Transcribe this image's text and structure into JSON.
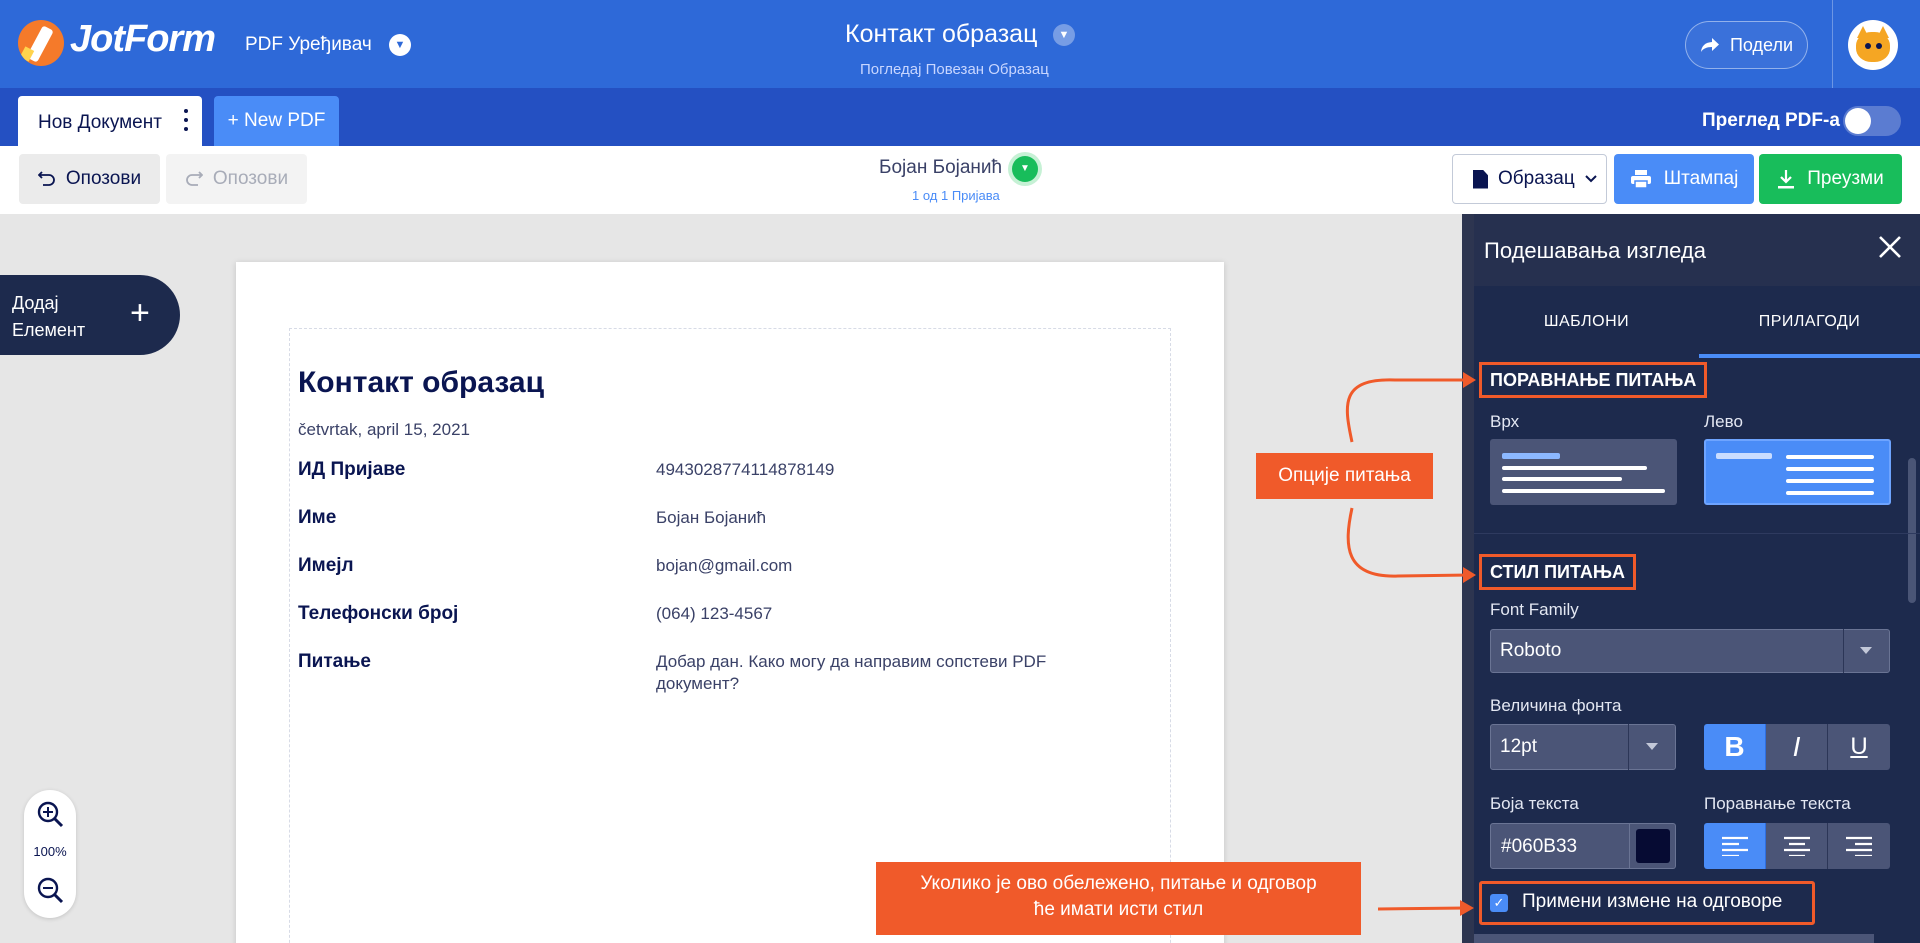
{
  "header": {
    "logo_text": "JotForm",
    "app_name": "PDF Уређивач",
    "form_title": "Контакт образац",
    "form_subtitle": "Погледај Повезан Образац",
    "share_label": "Подели"
  },
  "tabs": {
    "document_label": "Нов Документ",
    "new_pdf_label": "+ New PDF",
    "preview_label": "Преглед PDF-а",
    "preview_on": false
  },
  "toolbar": {
    "undo_label": "Опозови",
    "redo_label": "Опозови",
    "submitter_name": "Бојан Бојанић",
    "submission_count": "1 од 1 Пријава",
    "template_label": "Образац",
    "print_label": "Штампај",
    "download_label": "Преузми"
  },
  "canvas": {
    "add_element_label": "Додај Елемент",
    "zoom_level": "100%"
  },
  "document": {
    "title": "Контакт образац",
    "date": "četvrtak, april 15, 2021",
    "fields": [
      {
        "label": "ИД Пријаве",
        "value": "4943028774114878149"
      },
      {
        "label": "Име",
        "value": "Бојан Бојанић"
      },
      {
        "label": "Имејл",
        "value": "bojan@gmail.com"
      },
      {
        "label": "Телефонски број",
        "value": "(064) 123-4567"
      },
      {
        "label": "Питање",
        "value": "Добар дан. Како могу да направим сопстеви PDF документ?"
      }
    ]
  },
  "panel": {
    "title": "Подешавања изгледа",
    "tab_templates": "ШАБЛОНИ",
    "tab_customize": "ПРИЛАГОДИ",
    "question_alignment_title": "ПОРАВНАЊЕ ПИТАЊА",
    "align_top_label": "Врх",
    "align_left_label": "Лево",
    "question_style_title": "СТИЛ ПИТАЊА",
    "font_family_label": "Font Family",
    "font_family_value": "Roboto",
    "font_size_label": "Величина фонта",
    "font_size_value": "12pt",
    "bold_label": "B",
    "italic_label": "I",
    "underline_label": "U",
    "text_color_label": "Боја текста",
    "text_color_value": "#060B33",
    "text_align_label": "Поравнање текста",
    "apply_to_answers_label": "Примени измене на одговоре",
    "apply_to_answers_checked": true
  },
  "callouts": {
    "question_options": "Опције питања",
    "apply_note_line1": "Уколико је ово обележено, питање и одговор",
    "apply_note_line2": "ће имати исти стил"
  },
  "colors": {
    "header_blue": "#2e69d8",
    "tab_bar_blue": "#2450c2",
    "accent_blue": "#4a8cf7",
    "green": "#18bd5b",
    "panel_navy": "#1d2a4d",
    "callout_orange": "#f05a2a",
    "text_color_swatch": "#060b33"
  }
}
